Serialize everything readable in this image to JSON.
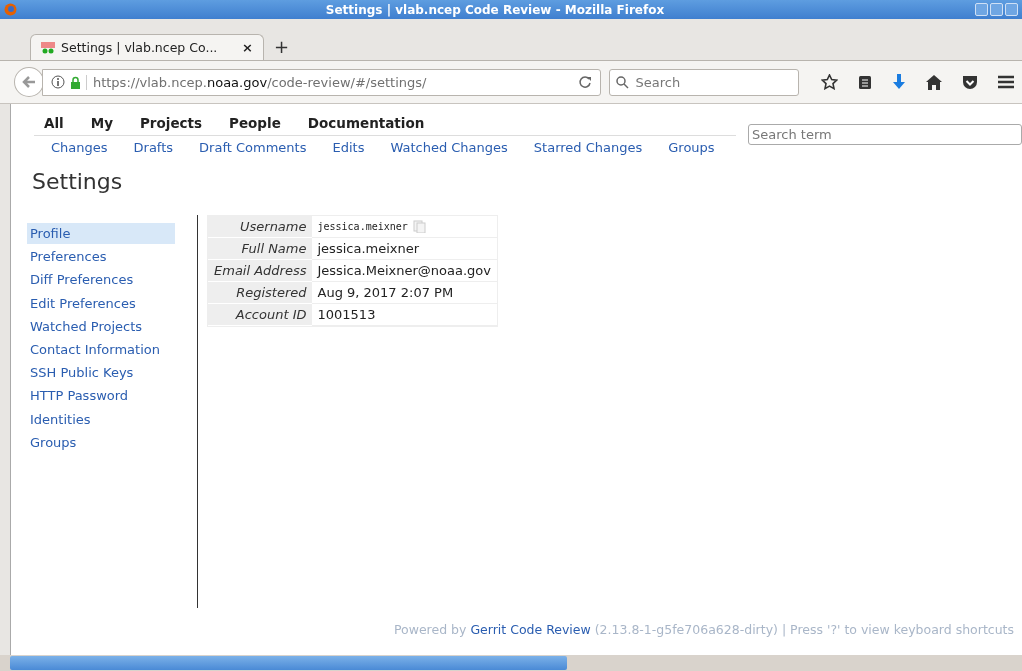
{
  "window": {
    "title": "Settings | vlab.ncep Code Review - Mozilla Firefox"
  },
  "tabs": [
    {
      "label": "Settings | vlab.ncep Co...",
      "selected": true
    }
  ],
  "new_tab": "+",
  "close_tab": "×",
  "address": {
    "url": "https://vlab.ncep.**noaa.gov**/code-review/#/settings/"
  },
  "browser_search": {
    "placeholder": "Search"
  },
  "main_menu": [
    {
      "label": "All"
    },
    {
      "label": "My"
    },
    {
      "label": "Projects"
    },
    {
      "label": "People"
    },
    {
      "label": "Documentation"
    }
  ],
  "sub_menu": [
    {
      "label": "Changes"
    },
    {
      "label": "Drafts"
    },
    {
      "label": "Draft Comments"
    },
    {
      "label": "Edits"
    },
    {
      "label": "Watched Changes"
    },
    {
      "label": "Starred Changes"
    },
    {
      "label": "Groups"
    }
  ],
  "search_term": {
    "placeholder": "Search term"
  },
  "page_title": "Settings",
  "sidebar": {
    "items": [
      {
        "label": "Profile",
        "selected": true
      },
      {
        "label": "Preferences",
        "selected": false
      },
      {
        "label": "Diff Preferences",
        "selected": false
      },
      {
        "label": "Edit Preferences",
        "selected": false
      },
      {
        "label": "Watched Projects",
        "selected": false
      },
      {
        "label": "Contact Information",
        "selected": false
      },
      {
        "label": "SSH Public Keys",
        "selected": false
      },
      {
        "label": "HTTP Password",
        "selected": false
      },
      {
        "label": "Identities",
        "selected": false
      },
      {
        "label": "Groups",
        "selected": false
      }
    ]
  },
  "profile": [
    {
      "label": "Username",
      "value": "jessica.meixner",
      "kind": "copyable"
    },
    {
      "label": "Full Name",
      "value": "jessica.meixner",
      "kind": "text"
    },
    {
      "label": "Email Address",
      "value": "Jessica.Meixner@noaa.gov",
      "kind": "text"
    },
    {
      "label": "Registered",
      "value": "Aug 9, 2017 2:07 PM",
      "kind": "text"
    },
    {
      "label": "Account ID",
      "value": "1001513",
      "kind": "text"
    }
  ],
  "footer": {
    "prefix": "Powered by",
    "link": "Gerrit Code Review",
    "suffix": "(2.13.8-1-g5fe706a628-dirty) | Press '?' to view keyboard shortcuts"
  }
}
